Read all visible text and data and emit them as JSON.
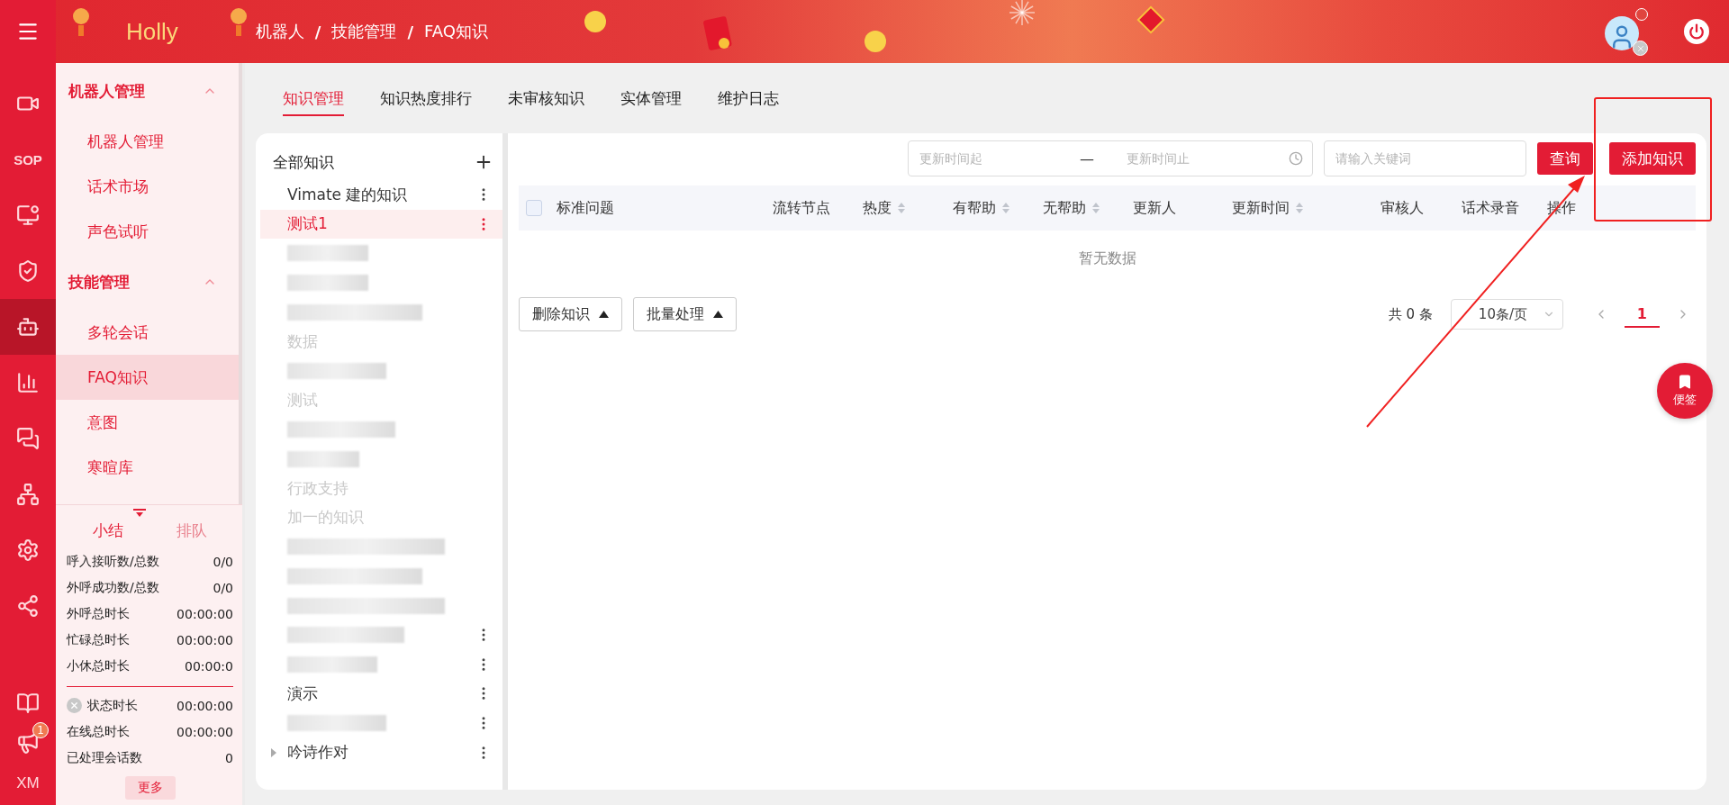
{
  "header": {
    "brand": "Holly",
    "breadcrumbs": [
      "机器人",
      "技能管理",
      "FAQ知识"
    ],
    "separator": "/"
  },
  "rail": [
    {
      "kind": "icon",
      "selected": false
    },
    {
      "kind": "text",
      "label": "SOP",
      "selected": false
    },
    {
      "kind": "icon",
      "selected": false
    },
    {
      "kind": "icon",
      "selected": false
    },
    {
      "kind": "icon",
      "selected": true
    },
    {
      "kind": "icon",
      "selected": false
    },
    {
      "kind": "icon",
      "selected": false
    },
    {
      "kind": "icon",
      "selected": false
    },
    {
      "kind": "icon",
      "selected": false
    },
    {
      "kind": "icon",
      "selected": false
    }
  ],
  "rail_bottom": {
    "badge": "1",
    "initials": "XM"
  },
  "sidebar": {
    "groups": [
      {
        "title": "机器人管理",
        "expanded": true,
        "items": [
          {
            "label": "机器人管理",
            "selected": false
          },
          {
            "label": "话术市场",
            "selected": false
          },
          {
            "label": "声色试听",
            "selected": false
          }
        ]
      },
      {
        "title": "技能管理",
        "expanded": true,
        "items": [
          {
            "label": "多轮会话",
            "selected": false
          },
          {
            "label": "FAQ知识",
            "selected": true
          },
          {
            "label": "意图",
            "selected": false
          },
          {
            "label": "寒暄库",
            "selected": false
          }
        ]
      }
    ]
  },
  "stats": {
    "tabs": [
      {
        "label": "小结",
        "selected": true
      },
      {
        "label": "排队",
        "selected": false
      }
    ],
    "rows": [
      {
        "label": "呼入接听数/总数",
        "value": "0/0"
      },
      {
        "label": "外呼成功数/总数",
        "value": "0/0"
      },
      {
        "label": "外呼总时长",
        "value": "00:00:00"
      },
      {
        "label": "忙碌总时长",
        "value": "00:00:00"
      },
      {
        "label": "小休总时长",
        "value": "00:00:0"
      }
    ],
    "status_rows": [
      {
        "label": "状态时长",
        "value": "00:00:00",
        "kind": "status"
      },
      {
        "label": "在线总时长",
        "value": "00:00:00",
        "kind": "plain"
      },
      {
        "label": "已处理会话数",
        "value": "0",
        "kind": "plain"
      }
    ],
    "more_button": "更多"
  },
  "tabs": [
    {
      "label": "知识管理",
      "selected": true
    },
    {
      "label": "知识热度排行",
      "selected": false
    },
    {
      "label": "未审核知识",
      "selected": false
    },
    {
      "label": "实体管理",
      "selected": false
    },
    {
      "label": "维护日志",
      "selected": false
    }
  ],
  "tree": {
    "title": "全部知识",
    "items": [
      {
        "kind": "leaf",
        "label": "Vimate 建的知识",
        "selected": false,
        "disabled": false,
        "menu": true
      },
      {
        "kind": "leaf",
        "label": "测试1",
        "selected": true,
        "disabled": false,
        "menu": true
      },
      {
        "kind": "blurred",
        "menu": false
      },
      {
        "kind": "blurred",
        "menu": false
      },
      {
        "kind": "blurred",
        "menu": false
      },
      {
        "kind": "leaf",
        "label": "数据",
        "selected": false,
        "disabled": true,
        "menu": false
      },
      {
        "kind": "blurred",
        "menu": false
      },
      {
        "kind": "leaf",
        "label": "测试",
        "selected": false,
        "disabled": true,
        "menu": false
      },
      {
        "kind": "blurred",
        "menu": false
      },
      {
        "kind": "blurred",
        "menu": false
      },
      {
        "kind": "leaf",
        "label": "行政支持",
        "selected": false,
        "disabled": true,
        "menu": false
      },
      {
        "kind": "leaf",
        "label": "加一的知识",
        "selected": false,
        "disabled": true,
        "menu": false
      },
      {
        "kind": "blurred",
        "menu": false
      },
      {
        "kind": "blurred",
        "menu": false
      },
      {
        "kind": "blurred",
        "menu": false
      },
      {
        "kind": "blurred",
        "menu": true
      },
      {
        "kind": "blurred",
        "menu": true
      },
      {
        "kind": "leaf",
        "label": "演示",
        "selected": false,
        "disabled": false,
        "menu": true
      },
      {
        "kind": "blurred",
        "menu": true
      },
      {
        "kind": "folder",
        "label": "吟诗作对",
        "selected": false,
        "disabled": false,
        "menu": true,
        "expanded": false
      }
    ]
  },
  "filters": {
    "date_from": {
      "placeholder": "更新时间起"
    },
    "separator": "—",
    "date_to": {
      "placeholder": "更新时间止"
    },
    "keyword": {
      "placeholder": "请输入关键词"
    },
    "search_button": "查询",
    "add_button": "添加知识"
  },
  "table": {
    "select_all": {
      "checked": false
    },
    "columns": [
      {
        "label": "标准问题",
        "sortable": false
      },
      {
        "label": "流转节点",
        "sortable": false
      },
      {
        "label": "热度",
        "sortable": true
      },
      {
        "label": "有帮助",
        "sortable": true
      },
      {
        "label": "无帮助",
        "sortable": true
      },
      {
        "label": "更新人",
        "sortable": false
      },
      {
        "label": "更新时间",
        "sortable": true
      },
      {
        "label": "审核人",
        "sortable": false
      },
      {
        "label": "话术录音",
        "sortable": false
      },
      {
        "label": "操作",
        "sortable": false
      }
    ],
    "empty_text": "暂无数据"
  },
  "footer": {
    "buttons": [
      "删除知识",
      "批量处理"
    ],
    "total": "共 0 条",
    "page_size": "10条/页",
    "pages": [
      {
        "label": "1",
        "selected": true
      }
    ]
  },
  "float_button": "便签"
}
